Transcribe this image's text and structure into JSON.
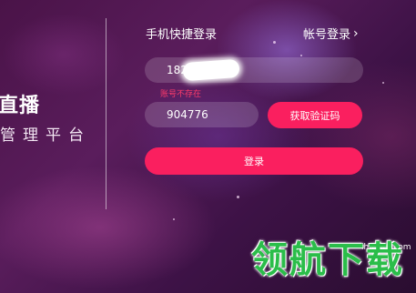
{
  "brand": {
    "title": "直播",
    "subtitle": "管理平台"
  },
  "login": {
    "tab_phone": "手机快捷登录",
    "tab_account": "帐号登录",
    "tab_account_icon": "chevron-right-icon",
    "phone_value": "1828",
    "phone_error": "账号不存在",
    "code_value": "904776",
    "get_code_label": "获取验证码",
    "submit_label": "登录"
  },
  "watermark": {
    "site": "lhdown.com",
    "logo_text": "领航下载"
  },
  "colors": {
    "accent": "#fa1f5f",
    "error": "#ff3b6b",
    "watermark_green": "#2bbd4a"
  }
}
